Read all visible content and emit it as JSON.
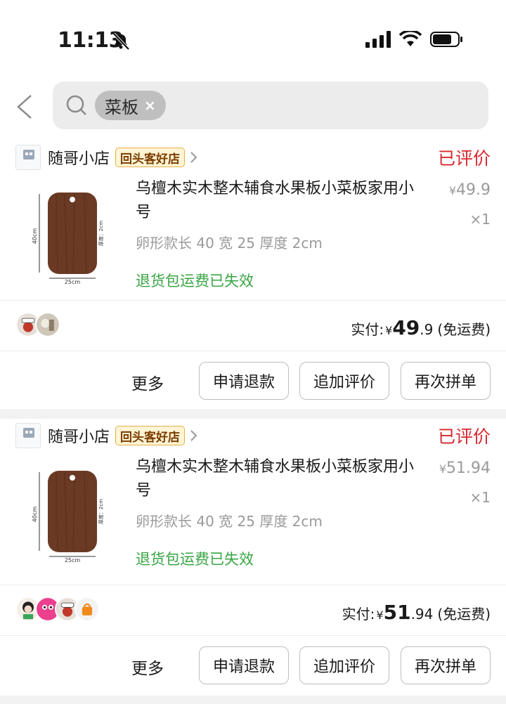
{
  "status_bar": {
    "time": "11:13"
  },
  "search": {
    "chip_label": "菜板",
    "chip_close": "×"
  },
  "orders": [
    {
      "shop_name": "随哥小店",
      "shop_badge": "回头客好店",
      "status": "已评价",
      "title": "乌檀木实木整木辅食水果板小菜板家用小号",
      "spec": "卵形款长 40 宽 25 厚度 2cm",
      "policy": "退货包运费已失效",
      "unit_price_symbol": "¥",
      "unit_price_int": "49",
      "unit_price_dec": ".9",
      "quantity": "×1",
      "paid_label": "实付:",
      "paid_symbol": "¥",
      "paid_int": "49",
      "paid_dec": ".9",
      "paid_note": "(免运费)",
      "actions": {
        "more": "更多",
        "refund": "申请退款",
        "add_review": "追加评价",
        "reorder": "再次拼单"
      }
    },
    {
      "shop_name": "随哥小店",
      "shop_badge": "回头客好店",
      "status": "已评价",
      "title": "乌檀木实木整木辅食水果板小菜板家用小号",
      "spec": "卵形款长 40 宽 25 厚度 2cm",
      "policy": "退货包运费已失效",
      "unit_price_symbol": "¥",
      "unit_price_int": "51",
      "unit_price_dec": ".94",
      "quantity": "×1",
      "paid_label": "实付:",
      "paid_symbol": "¥",
      "paid_int": "51",
      "paid_dec": ".94",
      "paid_note": "(免运费)",
      "actions": {
        "more": "更多",
        "refund": "申请退款",
        "add_review": "追加评价",
        "reorder": "再次拼单"
      }
    }
  ],
  "product_image": {
    "dim_length": "40cm",
    "dim_width": "25cm",
    "dim_thickness": "厚度：2cm"
  },
  "shop_logo_caption": "随哥小店",
  "colors": {
    "status_red": "#d9272e",
    "policy_green": "#39a544",
    "badge_gold": "#e4b04a",
    "wood": "#6b3a24"
  }
}
